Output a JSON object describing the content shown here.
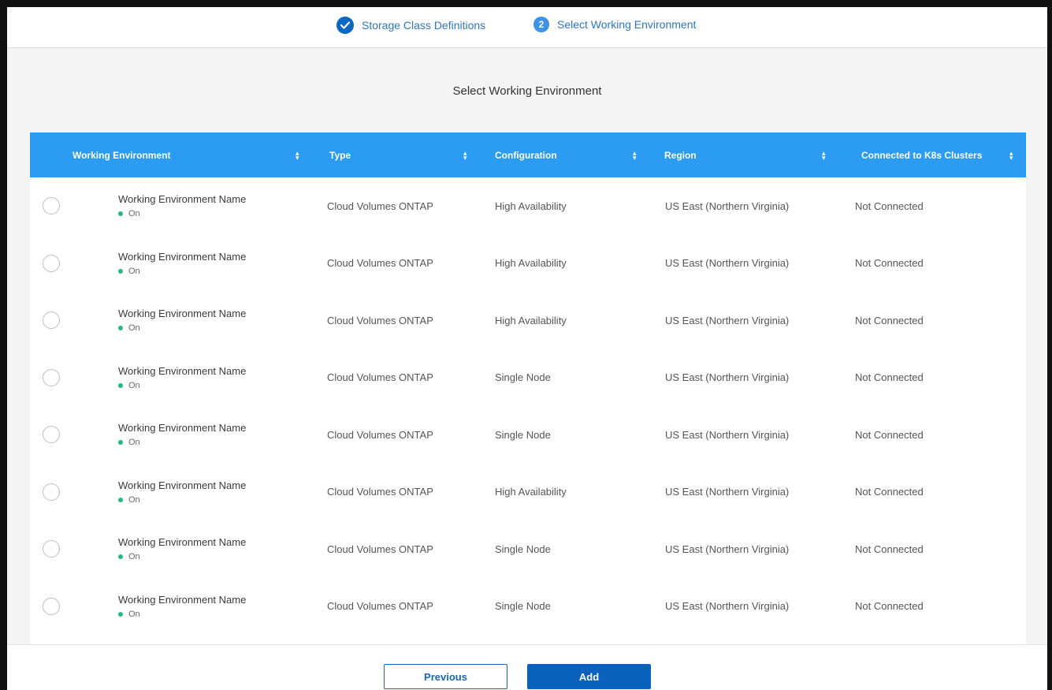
{
  "stepper": {
    "steps": [
      {
        "label": "Storage Class Definitions",
        "state": "done"
      },
      {
        "number": "2",
        "label": "Select Working Environment",
        "state": "active"
      }
    ]
  },
  "page": {
    "title": "Select Working Environment"
  },
  "table": {
    "columns": [
      "Working Environment",
      "Type",
      "Configuration",
      "Region",
      "Connected to K8s Clusters"
    ],
    "rows": [
      {
        "name": "Working Environment Name",
        "status": "On",
        "type": "Cloud Volumes ONTAP",
        "configuration": "High Availability",
        "region": "US East (Northern Virginia)",
        "connected": "Not Connected"
      },
      {
        "name": "Working Environment Name",
        "status": "On",
        "type": "Cloud Volumes ONTAP",
        "configuration": "High Availability",
        "region": "US East (Northern Virginia)",
        "connected": "Not Connected"
      },
      {
        "name": "Working Environment Name",
        "status": "On",
        "type": "Cloud Volumes ONTAP",
        "configuration": "High Availability",
        "region": "US East (Northern Virginia)",
        "connected": "Not Connected"
      },
      {
        "name": "Working Environment Name",
        "status": "On",
        "type": "Cloud Volumes ONTAP",
        "configuration": "Single Node",
        "region": "US East (Northern Virginia)",
        "connected": "Not Connected"
      },
      {
        "name": "Working Environment Name",
        "status": "On",
        "type": "Cloud Volumes ONTAP",
        "configuration": "Single Node",
        "region": "US East (Northern Virginia)",
        "connected": "Not Connected"
      },
      {
        "name": "Working Environment Name",
        "status": "On",
        "type": "Cloud Volumes ONTAP",
        "configuration": "High Availability",
        "region": "US East (Northern Virginia)",
        "connected": "Not Connected"
      },
      {
        "name": "Working Environment Name",
        "status": "On",
        "type": "Cloud Volumes ONTAP",
        "configuration": "Single Node",
        "region": "US East (Northern Virginia)",
        "connected": "Not Connected"
      },
      {
        "name": "Working Environment Name",
        "status": "On",
        "type": "Cloud Volumes ONTAP",
        "configuration": "Single Node",
        "region": "US East (Northern Virginia)",
        "connected": "Not Connected"
      }
    ]
  },
  "footer": {
    "previous_label": "Previous",
    "add_label": "Add"
  },
  "colors": {
    "header_blue": "#2b9cf2",
    "primary": "#0b62bd",
    "status_on": "#28b77c"
  }
}
